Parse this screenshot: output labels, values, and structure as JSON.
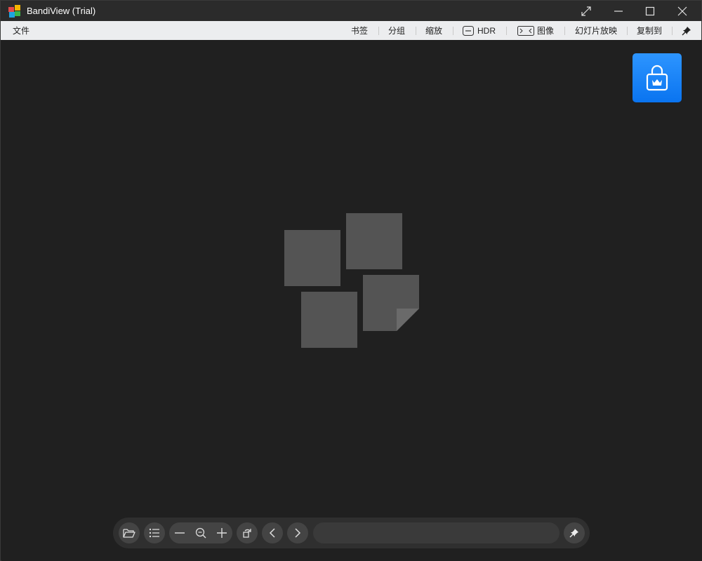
{
  "window": {
    "title": "BandiView (Trial)",
    "colors": {
      "titlebar": "#2b2b2b",
      "menubar": "#ecedef",
      "canvas": "#202020",
      "accent": "#1a85ff"
    }
  },
  "titlebar_buttons": {
    "fullscreen_icon": "expand-icon",
    "minimize_icon": "minimize-icon",
    "maximize_icon": "maximize-icon",
    "close_icon": "close-icon"
  },
  "menu": {
    "file": "文件",
    "bookmark": "书签",
    "group": "分组",
    "zoom": "缩放",
    "hdr": "HDR",
    "image": "图像",
    "slideshow": "幻灯片放映",
    "copy_to": "复制到"
  },
  "premium": {
    "icon": "lock-crown-icon"
  },
  "toolbar": {
    "filename": "",
    "icons": [
      "folder-open-icon",
      "list-icon",
      "zoom-out-minus-icon",
      "zoom-fit-icon",
      "zoom-in-plus-icon",
      "rotate-icon",
      "prev-icon",
      "next-icon",
      "pin-icon"
    ]
  }
}
